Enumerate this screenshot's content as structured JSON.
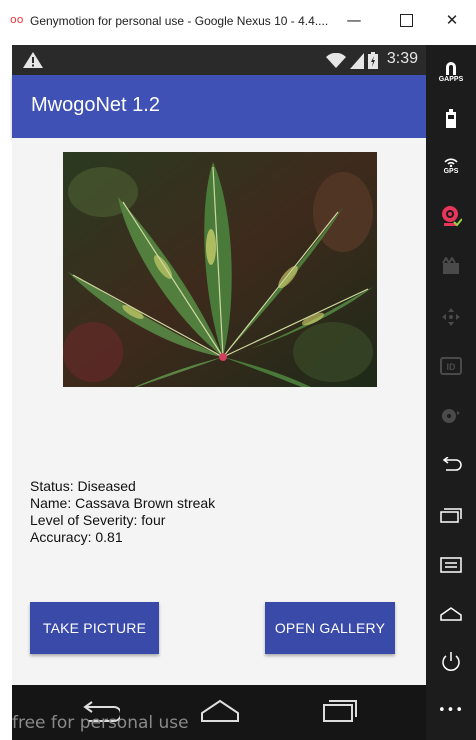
{
  "window": {
    "title": "Genymotion for personal use - Google Nexus 10 - 4.4....",
    "logo_glyph": "oo",
    "minimize_glyph": "—",
    "close_glyph": "✕"
  },
  "statusbar": {
    "time": "3:39"
  },
  "app": {
    "title": "MwogoNet 1.2"
  },
  "result": {
    "status": "Status: Diseased",
    "name": "Name: Cassava Brown streak",
    "severity": "Level of Severity: four",
    "accuracy": "Accuracy: 0.81"
  },
  "buttons": {
    "take_picture": "TAKE PICTURE",
    "open_gallery": "OPEN GALLERY"
  },
  "watermark": "free for personal use",
  "sidebar": {
    "gapps_label": "GAPPS",
    "gps_label": "GPS",
    "id_label": "ID",
    "more_glyph": "•••"
  },
  "colors": {
    "appbar": "#3f51b5",
    "button": "#3a4aa8"
  }
}
